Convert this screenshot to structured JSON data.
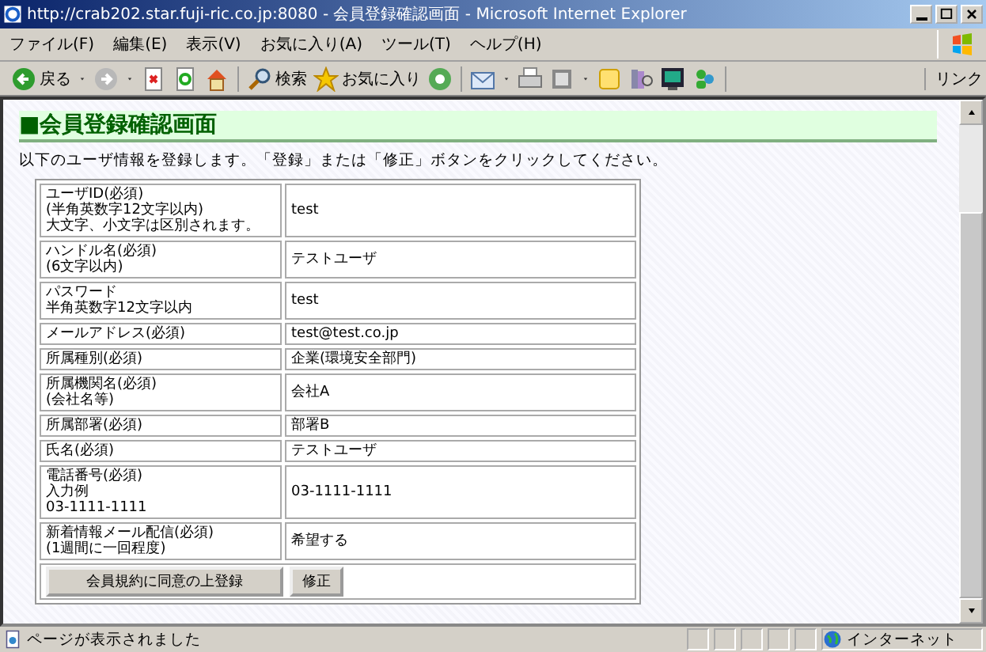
{
  "window": {
    "title": "http://crab202.star.fuji-ric.co.jp:8080 - 会員登録確認画面 - Microsoft Internet Explorer"
  },
  "menu": [
    "ファイル(F)",
    "編集(E)",
    "表示(V)",
    "お気に入り(A)",
    "ツール(T)",
    "ヘルプ(H)"
  ],
  "toolbar": {
    "groups": [
      [
        {
          "kind": "back",
          "label": "戻る",
          "dropdown": true
        },
        {
          "kind": "forward",
          "dropdown": true
        },
        {
          "kind": "stop"
        },
        {
          "kind": "refresh"
        },
        {
          "kind": "home"
        }
      ],
      [
        {
          "kind": "search",
          "label": "検索"
        },
        {
          "kind": "favorites",
          "label": "お気に入り"
        },
        {
          "kind": "media"
        }
      ],
      [
        {
          "kind": "mail",
          "dropdown": true
        },
        {
          "kind": "print"
        },
        {
          "kind": "edit",
          "dropdown": true
        },
        {
          "kind": "note"
        },
        {
          "kind": "research"
        },
        {
          "kind": "messenger-app"
        },
        {
          "kind": "messenger"
        }
      ]
    ],
    "links": "リンク"
  },
  "page": {
    "heading": "■会員登録確認画面",
    "description": "以下のユーザ情報を登録します。「登録」または「修正」ボタンをクリックしてください。",
    "rows": [
      {
        "label": [
          "ユーザID(必須)",
          "(半角英数字12文字以内)",
          "大文字、小文字は区別されます。"
        ],
        "value": "test"
      },
      {
        "label": [
          "ハンドル名(必須)",
          "(6文字以内)"
        ],
        "value": "テストユーザ"
      },
      {
        "label": [
          "パスワード",
          "半角英数字12文字以内"
        ],
        "value": "test"
      },
      {
        "label": [
          "メールアドレス(必須)"
        ],
        "value": "test@test.co.jp"
      },
      {
        "label": [
          "所属種別(必須)"
        ],
        "value": "企業(環境安全部門)"
      },
      {
        "label": [
          "所属機関名(必須)",
          "(会社名等)"
        ],
        "value": "会社A"
      },
      {
        "label": [
          "所属部署(必須)"
        ],
        "value": "部署B"
      },
      {
        "label": [
          "氏名(必須)"
        ],
        "value": "テストユーザ"
      },
      {
        "label": [
          "電話番号(必須)",
          "入力例",
          "03-1111-1111"
        ],
        "value": "03-1111-1111"
      },
      {
        "label": [
          "新着情報メール配信(必須)",
          "(1週間に一回程度)"
        ],
        "value": "希望する"
      }
    ],
    "buttons": [
      {
        "label": "会員規約に同意の上登録",
        "kind": "register"
      },
      {
        "label": "修正",
        "kind": "edit"
      }
    ]
  },
  "status_bar": {
    "text": "ページが表示されました",
    "zone": "インターネット"
  }
}
